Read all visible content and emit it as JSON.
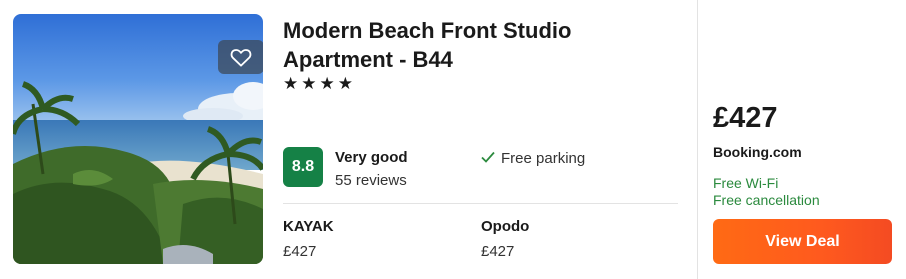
{
  "hotel": {
    "name": "Modern Beach Front Studio Apartment - B44",
    "stars": "★★★★",
    "star_count": 4
  },
  "rating": {
    "score": "8.8",
    "label": "Very good",
    "reviews": "55 reviews",
    "badge_color": "#158146"
  },
  "amenities": [
    "Free parking"
  ],
  "providers": [
    {
      "name": "KAYAK",
      "price": "£427"
    },
    {
      "name": "Opodo",
      "price": "£427"
    }
  ],
  "deal": {
    "price": "£427",
    "site": "Booking.com",
    "perks": [
      "Free Wi-Fi",
      "Free cancellation"
    ],
    "button_label": "View Deal",
    "button_color": "#ff5a1e",
    "perk_color": "#2b8a3e"
  },
  "icons": {
    "favorite": "heart-icon",
    "amenity": "check-icon"
  }
}
